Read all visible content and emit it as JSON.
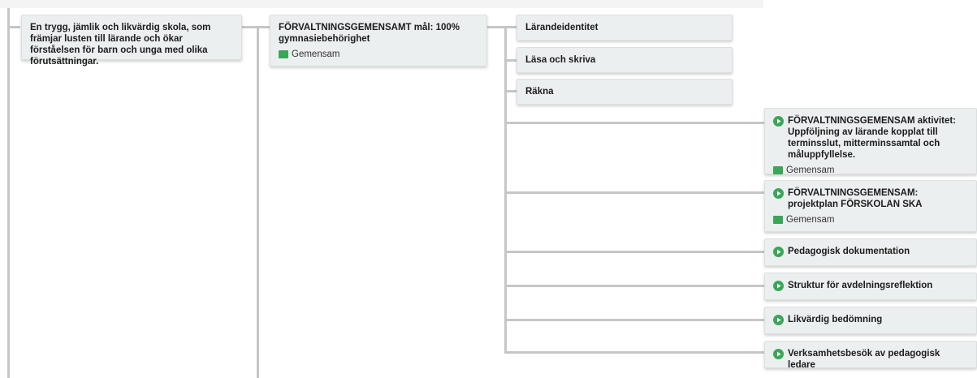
{
  "colors": {
    "accent": "#3aa657",
    "connector": "#c6c6c6",
    "node_bg": "#eceff0"
  },
  "goal": {
    "text": "En trygg, jämlik och likvärdig skola, som främjar lusten till lärande och ökar förståelsen för barn och unga med olika förutsättningar."
  },
  "subgoal": {
    "text": "FÖRVALTNINGSGEMENSAMT mål: 100% gymnasiebehörighet",
    "tag": "Gemensam",
    "tag_icon": "flag-icon"
  },
  "focus_areas": [
    {
      "text": "Lärandeidentitet"
    },
    {
      "text": "Läsa och skriva"
    },
    {
      "text": "Räkna"
    }
  ],
  "activities": [
    {
      "text": "FÖRVALTNINGSGEMENSAM aktivitet: Uppföljning av lärande kopplat till terminsslut, mitterminssamtal och måluppfyllelse.",
      "tag": "Gemensam",
      "icon": "play-circle-icon"
    },
    {
      "text": "FÖRVALTNINGSGEMENSAM: projektplan FÖRSKOLAN SKA",
      "tag": "Gemensam",
      "icon": "play-circle-icon"
    },
    {
      "text": "Pedagogisk dokumentation",
      "icon": "play-circle-icon"
    },
    {
      "text": "Struktur för avdelningsreflektion",
      "icon": "play-circle-icon"
    },
    {
      "text": "Likvärdig bedömning",
      "icon": "play-circle-icon"
    },
    {
      "text": "Verksamhetsbesök av pedagogisk ledare",
      "icon": "play-circle-icon"
    }
  ]
}
